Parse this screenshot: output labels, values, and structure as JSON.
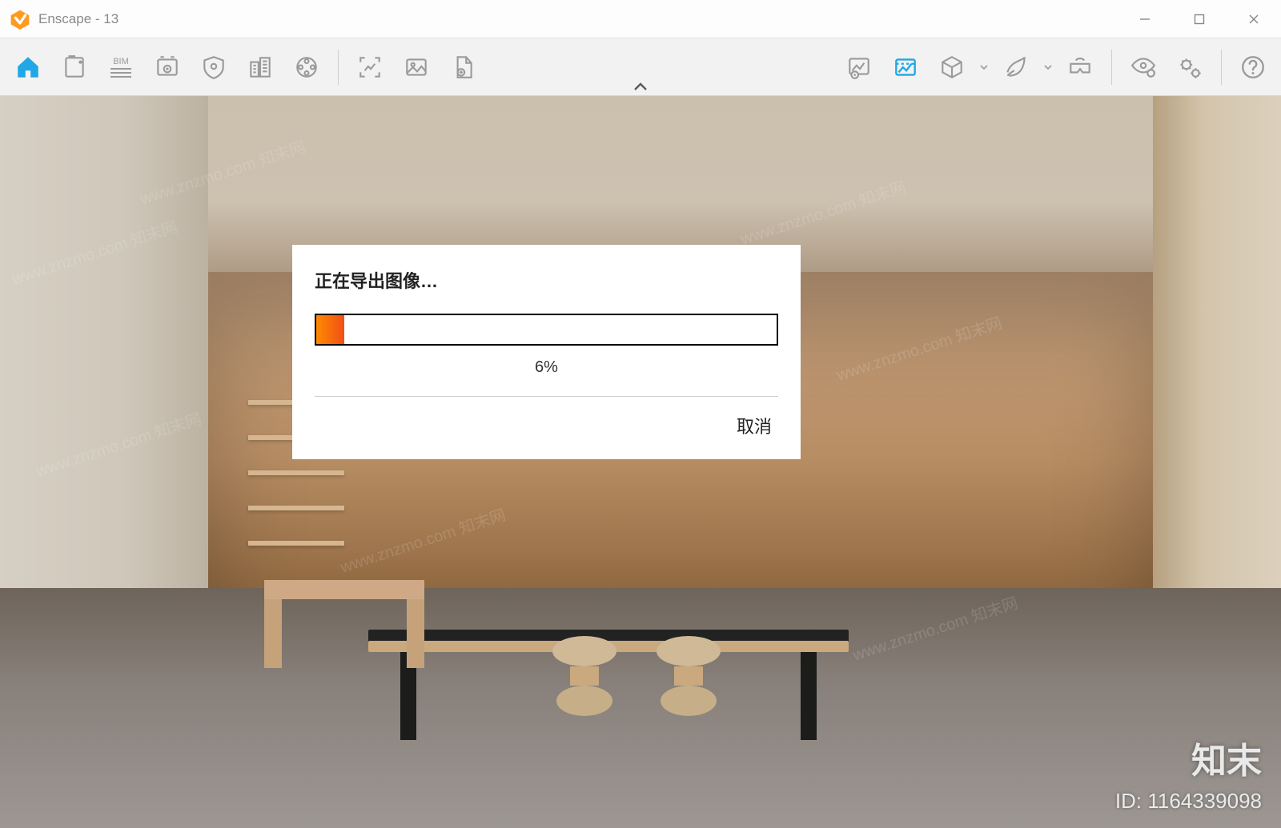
{
  "window": {
    "title": "Enscape - 13"
  },
  "toolbar": {
    "items": [
      {
        "id": "home",
        "name": "home-icon",
        "active": true
      },
      {
        "id": "page",
        "name": "page-icon",
        "active": false
      },
      {
        "id": "bim",
        "name": "bim-icon",
        "label": "BIM",
        "active": false
      },
      {
        "id": "views",
        "name": "views-icon",
        "active": false
      },
      {
        "id": "assets",
        "name": "shield-icon",
        "active": false
      },
      {
        "id": "collab",
        "name": "buildings-icon",
        "active": false
      },
      {
        "id": "video",
        "name": "reel-icon",
        "active": false
      }
    ],
    "items2": [
      {
        "id": "capture",
        "name": "capture-bracket-icon"
      },
      {
        "id": "image",
        "name": "image-icon"
      },
      {
        "id": "export",
        "name": "page-export-icon"
      }
    ],
    "items3": [
      {
        "id": "nav-image",
        "name": "nav-image-icon",
        "active": false
      },
      {
        "id": "image-settings",
        "name": "image-settings-icon",
        "active": true
      },
      {
        "id": "cube",
        "name": "cube-icon",
        "dropdown": true
      },
      {
        "id": "sustain",
        "name": "leaf-icon",
        "dropdown": true
      },
      {
        "id": "vr",
        "name": "vr-headset-icon"
      }
    ],
    "items4": [
      {
        "id": "visual-settings",
        "name": "eye-gear-icon"
      },
      {
        "id": "settings",
        "name": "gears-icon"
      }
    ],
    "help": {
      "id": "help",
      "name": "help-icon"
    }
  },
  "dialog": {
    "title": "正在导出图像…",
    "progress_percent": 6,
    "progress_label": "6%",
    "cancel_label": "取消"
  },
  "watermark": {
    "text": "www.znzmo.com 知末网",
    "brand": "知末",
    "id_label": "ID: 1164339098"
  }
}
